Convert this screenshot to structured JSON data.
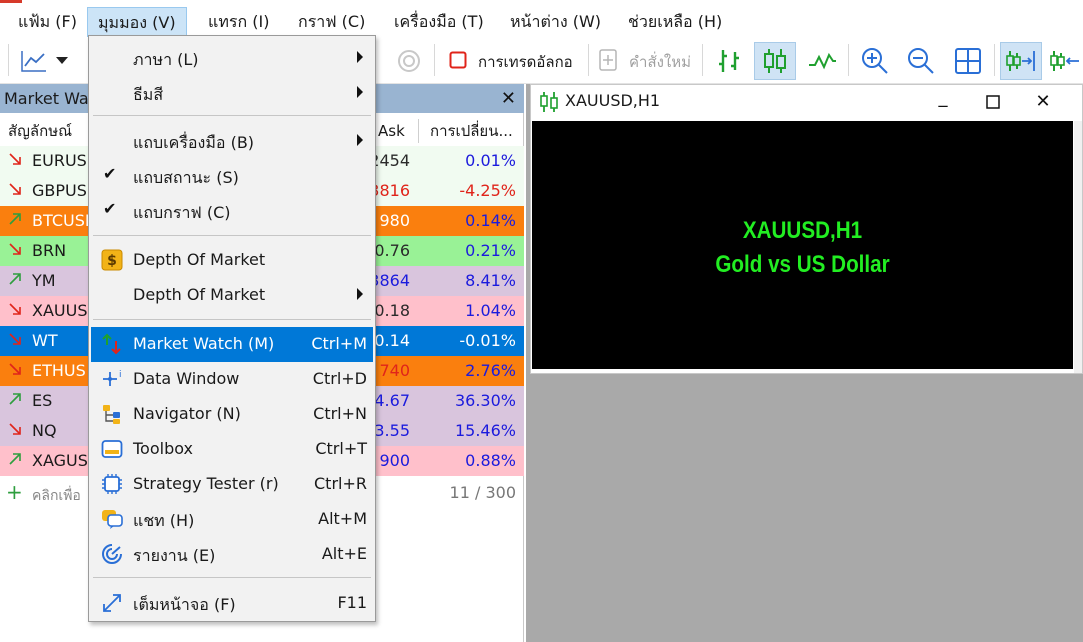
{
  "menubar": {
    "items": [
      "แฟ้ม (F)",
      "มุมมอง (V)",
      "แทรก (I)",
      "กราฟ (C)",
      "เครื่องมือ (T)",
      "หน้าต่าง (W)",
      "ช่วยเหลือ (H)"
    ]
  },
  "toolbar": {
    "algo_trading_label": "การเทรดอัลกอ",
    "new_order_label": "คำสั่งใหม่"
  },
  "market_watch": {
    "title": "Market Wa",
    "col_symbol": "สัญลักษณ์",
    "col_ask": "Ask",
    "col_change": "การเปลี่ยน...",
    "rows": [
      {
        "symbol": "EURUS",
        "ask": "2454",
        "change": "0.01%",
        "dir": "down",
        "bg": "#f1fbf1",
        "ask_color": "#2a2a2a",
        "chg_color": "#1b1bdd"
      },
      {
        "symbol": "GBPUS",
        "ask": "3816",
        "change": "-4.25%",
        "dir": "down",
        "bg": "#f1fbf1",
        "ask_color": "#e0241a",
        "chg_color": "#e0241a"
      },
      {
        "symbol": "BTCUSD",
        "ask": "980",
        "change": "0.14%",
        "dir": "up",
        "bg": "#fa7f0e",
        "ask_color": "#ffffff",
        "chg_color": "#1b1bdd",
        "sym_color": "#ffffff"
      },
      {
        "symbol": "BRN",
        "ask": "0.76",
        "change": "0.21%",
        "dir": "down",
        "bg": "#99f296",
        "ask_color": "#2a2a2a",
        "chg_color": "#1b1bdd"
      },
      {
        "symbol": "YM",
        "ask": "3864",
        "change": "8.41%",
        "dir": "up",
        "bg": "#d9c5dd",
        "ask_color": "#1b1bdd",
        "chg_color": "#1b1bdd"
      },
      {
        "symbol": "XAUUS",
        "ask": "0.18",
        "change": "1.04%",
        "dir": "down",
        "bg": "#ffc0cb",
        "ask_color": "#2a2a2a",
        "chg_color": "#1b1bdd"
      },
      {
        "symbol": "WT",
        "ask": "0.14",
        "change": "-0.01%",
        "dir": "down",
        "bg": "#0078d7",
        "ask_color": "#ffffff",
        "chg_color": "#ffffff",
        "sym_color": "#ffffff"
      },
      {
        "symbol": "ETHUS",
        "ask": "740",
        "change": "2.76%",
        "dir": "down",
        "bg": "#fa7f0e",
        "ask_color": "#e0241a",
        "chg_color": "#1b1bdd",
        "sym_color": "#ffffff"
      },
      {
        "symbol": "ES",
        "ask": "4.67",
        "change": "36.30%",
        "dir": "up",
        "bg": "#d9c5dd",
        "ask_color": "#1b1bdd",
        "chg_color": "#1b1bdd"
      },
      {
        "symbol": "NQ",
        "ask": "3.55",
        "change": "15.46%",
        "dir": "down",
        "bg": "#d9c5dd",
        "ask_color": "#1b1bdd",
        "chg_color": "#1b1bdd"
      },
      {
        "symbol": "XAGUS",
        "ask": "900",
        "change": "0.88%",
        "dir": "up",
        "bg": "#ffc0cb",
        "ask_color": "#1b1bdd",
        "chg_color": "#1b1bdd"
      }
    ],
    "add_hint": "คลิกเพื่อ",
    "count": "11 / 300"
  },
  "chart_window": {
    "title": "XAUUSD,H1",
    "line1": "XAUUSD,H1",
    "line2": "Gold vs US Dollar",
    "min_glyph": "_",
    "max_glyph": "☐",
    "close_glyph": "✕"
  },
  "view_menu": {
    "items": [
      {
        "label": "ภาษา (L)",
        "shortcut": "",
        "submenu": true,
        "check": false,
        "icon": ""
      },
      {
        "label": "ธีมสี",
        "shortcut": "",
        "submenu": true,
        "check": false,
        "icon": ""
      },
      {
        "label": "แถบเครื่องมือ (B)",
        "shortcut": "",
        "submenu": true,
        "check": false,
        "icon": ""
      },
      {
        "label": "แถบสถานะ (S)",
        "shortcut": "",
        "submenu": false,
        "check": true,
        "icon": ""
      },
      {
        "label": "แถบกราฟ (C)",
        "shortcut": "",
        "submenu": false,
        "check": true,
        "icon": ""
      },
      {
        "label": "Depth Of Market",
        "shortcut": "",
        "submenu": false,
        "check": false,
        "icon": "depth-of-market"
      },
      {
        "label": "Depth Of Market",
        "shortcut": "",
        "submenu": true,
        "check": false,
        "icon": ""
      },
      {
        "label": "Market Watch (M)",
        "shortcut": "Ctrl+M",
        "submenu": false,
        "check": false,
        "icon": "market-watch"
      },
      {
        "label": "Data Window",
        "shortcut": "Ctrl+D",
        "submenu": false,
        "check": false,
        "icon": "data-window"
      },
      {
        "label": "Navigator (N)",
        "shortcut": "Ctrl+N",
        "submenu": false,
        "check": false,
        "icon": "navigator"
      },
      {
        "label": "Toolbox",
        "shortcut": "Ctrl+T",
        "submenu": false,
        "check": false,
        "icon": "toolbox"
      },
      {
        "label": "Strategy Tester (r)",
        "shortcut": "Ctrl+R",
        "submenu": false,
        "check": false,
        "icon": "strategy-tester"
      },
      {
        "label": "แชท (H)",
        "shortcut": "Alt+M",
        "submenu": false,
        "check": false,
        "icon": "chat"
      },
      {
        "label": "รายงาน (E)",
        "shortcut": "Alt+E",
        "submenu": false,
        "check": false,
        "icon": "report"
      },
      {
        "label": "เต็มหน้าจอ (F)",
        "shortcut": "F11",
        "submenu": false,
        "check": false,
        "icon": "fullscreen"
      }
    ],
    "check_glyph": "✔"
  },
  "colors": {
    "accent": "#0078d7",
    "chart_text": "#22ee22",
    "up_arrow": "#2e9e3e",
    "down_arrow": "#e0241a"
  }
}
